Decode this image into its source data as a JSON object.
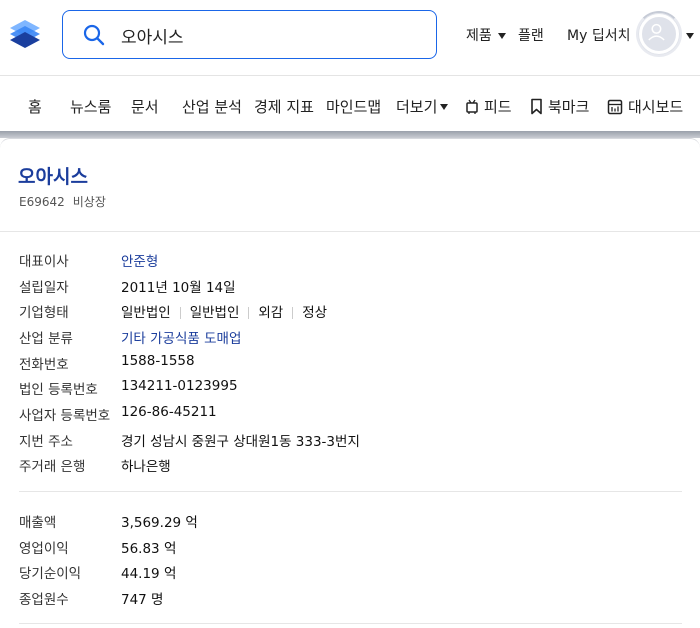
{
  "header": {
    "search_value": "오아시스",
    "products_label": "제품",
    "plans_label": "플랜",
    "my_search_label": "My 딥서치"
  },
  "nav": {
    "items": [
      "홈",
      "뉴스룸",
      "문서",
      "산업 분석",
      "경제 지표",
      "마인드맵",
      "더보기",
      "피드",
      "북마크",
      "대시보드"
    ]
  },
  "company": {
    "name": "오아시스",
    "code": "E69642",
    "listing_status": "비상장",
    "info": [
      {
        "label": "대표이사",
        "value": "안준형"
      },
      {
        "label": "설립일자",
        "value": "2011년 10월 14일"
      },
      {
        "label": "기업형태",
        "values": [
          "일반법인",
          "일반법인",
          "외감",
          "정상"
        ]
      },
      {
        "label": "산업 분류",
        "value": "기타 가공식품 도매업"
      },
      {
        "label": "전화번호",
        "value": "1588-1558"
      },
      {
        "label": "법인 등록번호",
        "value": "134211-0123995"
      },
      {
        "label": "사업자 등록번호",
        "value": "126-86-45211"
      },
      {
        "label": "지번 주소",
        "value": "경기 성남시 중원구 상대원1동 333-3번지"
      },
      {
        "label": "주거래 은행",
        "value": "하나은행"
      }
    ],
    "financials": [
      {
        "label": "매출액",
        "value": "3,569.29 억"
      },
      {
        "label": "영업이익",
        "value": "56.83 억"
      },
      {
        "label": "당기순이익",
        "value": "44.19 억"
      },
      {
        "label": "종업원수",
        "value": "747 명"
      }
    ]
  },
  "colors": {
    "accent": "#1a66e8",
    "link": "#1b3d9c"
  }
}
